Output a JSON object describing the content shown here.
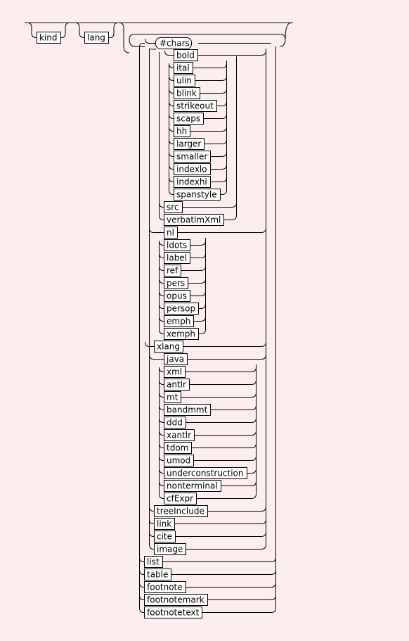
{
  "diagram": {
    "type": "railroad-syntax-diagram",
    "background": "#fdeeee",
    "line_color": "#000000",
    "box_fill": "#ffffff",
    "optional_prefixes": [
      "kind",
      "lang"
    ],
    "main_choice": {
      "literal": "#chars",
      "inline_group": [
        "bold",
        "ital",
        "ulin",
        "blink",
        "strikeout",
        "scaps",
        "hh",
        "larger",
        "smaller",
        "indexlo",
        "indexhi",
        "spanstyle"
      ],
      "after_inline": [
        "src",
        "verbatimXml"
      ],
      "misc_group": [
        "nl",
        "ldots",
        "label",
        "ref",
        "pers",
        "opus",
        "persop",
        "emph",
        "xemph"
      ],
      "xlang": "xlang",
      "code_group": [
        "java",
        "xml",
        "antlr",
        "mt",
        "bandmmt",
        "ddd",
        "xantlr",
        "tdom",
        "umod",
        "underconstruction",
        "nonterminal",
        "cfExpr"
      ],
      "ref_group": [
        "treeInclude",
        "link",
        "cite",
        "image"
      ],
      "block_group": [
        "list",
        "table",
        "footnote",
        "footnotemark",
        "footnotetext"
      ]
    }
  }
}
